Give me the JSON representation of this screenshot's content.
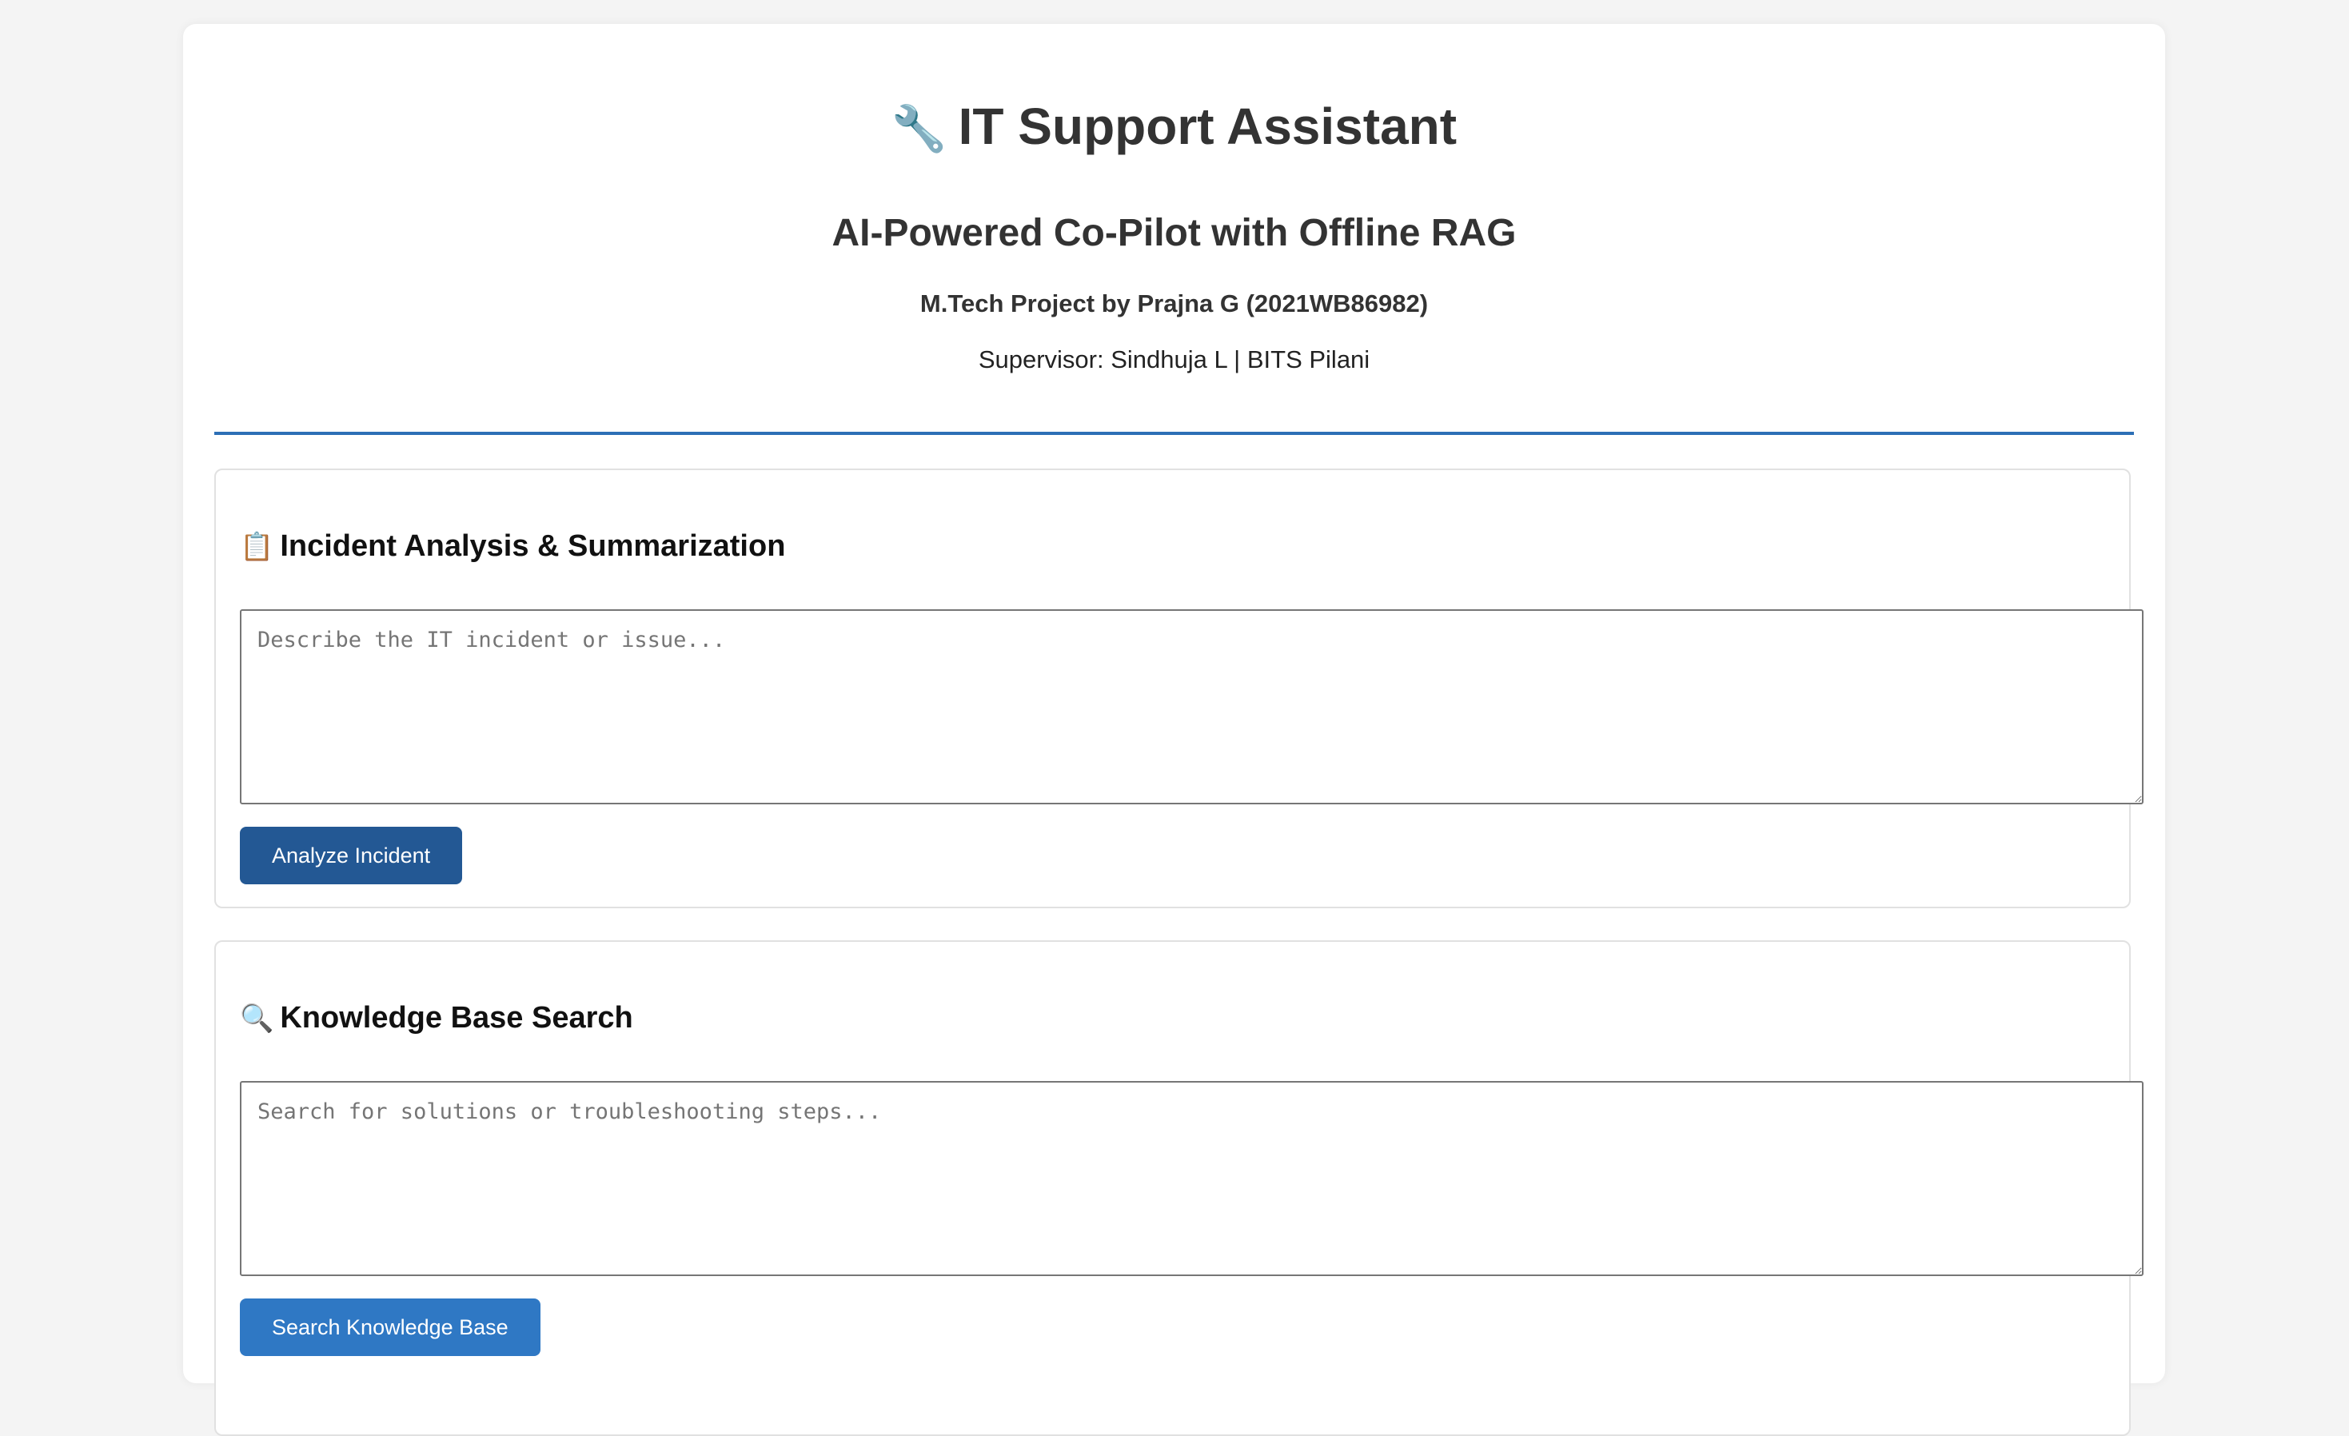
{
  "header": {
    "title_icon": "🔧",
    "title": "IT Support Assistant",
    "subtitle": "AI-Powered Co-Pilot with Offline RAG",
    "byline": "M.Tech Project by Prajna G (2021WB86982)",
    "supervisor": "Supervisor: Sindhuja L | BITS Pilani"
  },
  "incident": {
    "icon": "📋",
    "icon_name": "clipboard-icon",
    "heading": "Incident Analysis & Summarization",
    "placeholder": "Describe the IT incident or issue...",
    "value": "",
    "button_label": "Analyze Incident"
  },
  "kb": {
    "icon": "🔍",
    "icon_name": "magnifier-icon",
    "heading": "Knowledge Base Search",
    "placeholder": "Search for solutions or troubleshooting steps...",
    "value": "",
    "button_label": "Search Knowledge Base"
  },
  "colors": {
    "accent": "#2c6fb6",
    "button_dark": "#235894",
    "button_blue": "#2f78c4",
    "page_background": "#f4f4f4"
  }
}
